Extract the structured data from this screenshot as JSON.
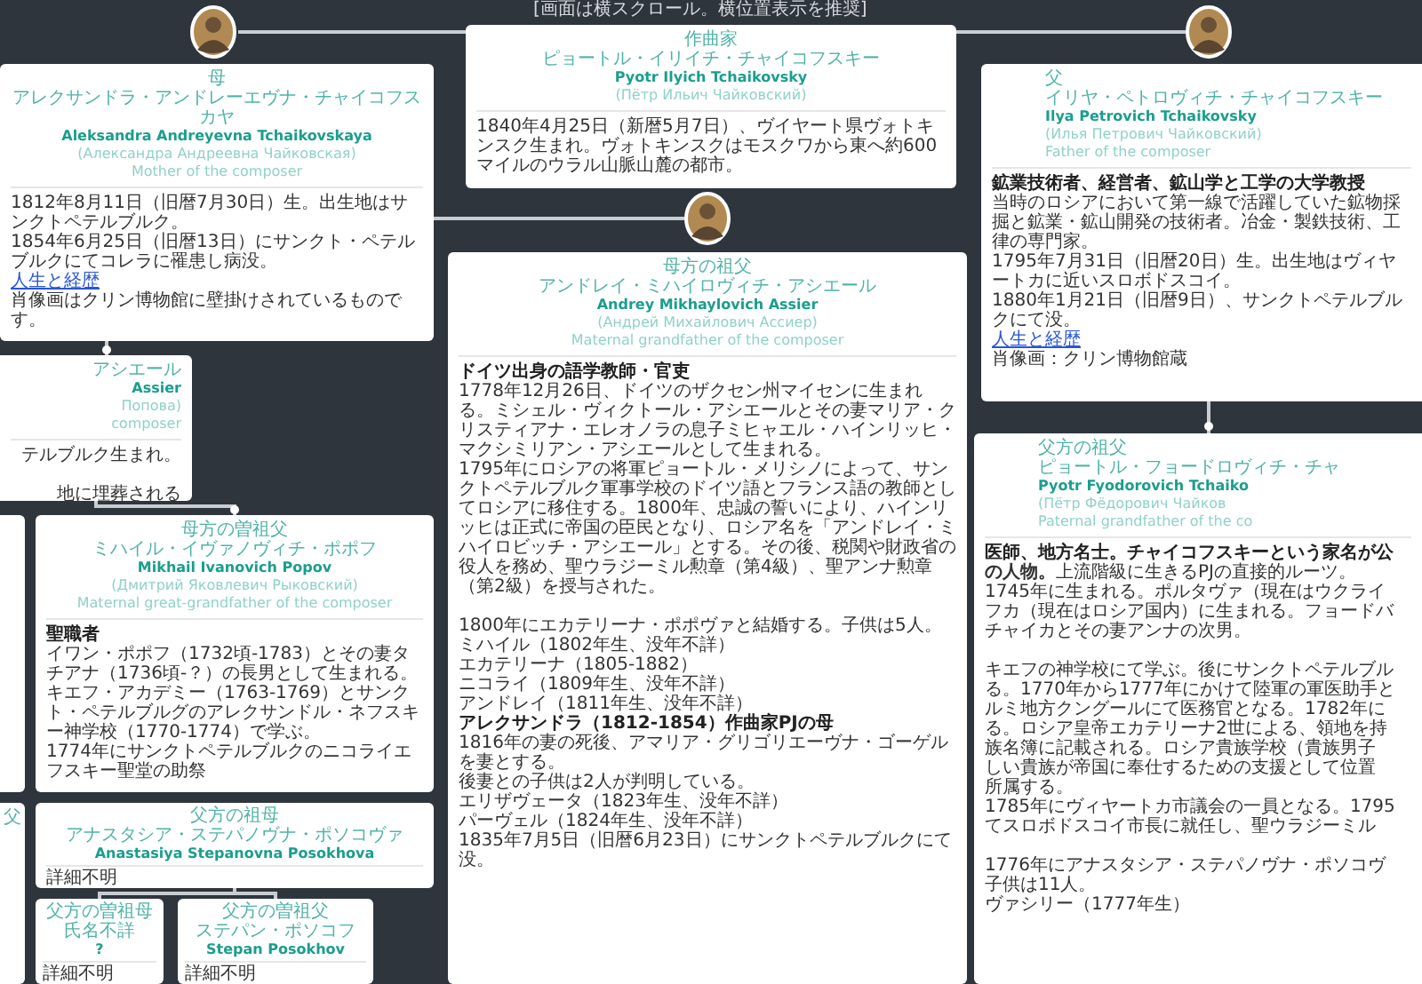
{
  "hint": "[画面は横スクロール。横位置表示を推奨]",
  "people": [
    {
      "role": "作曲家",
      "name_ja": "ピョートル・イリイチ・チャイコフスキー",
      "name_en": "Pyotr Ilyich Tchaikovsky",
      "name_ru": "(Пётр Ильич Чайковский)",
      "portrait": false,
      "bio": [
        {
          "kind": "text",
          "text": "1840年4月25日（新暦5月7日）、ヴイヤート県ヴォトキンスク生まれ。ヴォトキンスクはモスクワから東へ約600マイルのウラル山脈山麓の都市。"
        }
      ]
    },
    {
      "role": "母",
      "name_ja": "アレクサンドラ・アンドレーエヴナ・チャイコフスカヤ",
      "name_en": "Aleksandra Andreyevna Tchaikovskaya",
      "name_ru": "(Александра Андреевна Чайковская)",
      "role_en": "Mother of the composer",
      "portrait": true,
      "bio": [
        {
          "kind": "text",
          "text": "1812年8月11日（旧暦7月30日）生。出生地はサンクトペテルブルク。"
        },
        {
          "kind": "text",
          "text": "1854年6月25日（旧暦13日）にサンクト・ペテルブルクにてコレラに罹患し病没。"
        },
        {
          "kind": "link",
          "text": "人生と経歴"
        },
        {
          "kind": "text",
          "text": "肖像画はクリン博物館に壁掛けされているものです。"
        }
      ]
    },
    {
      "role": "父",
      "name_ja": "イリヤ・ペトロヴィチ・チャイコフスキー",
      "name_en": "Ilya Petrovich Tchaikovsky",
      "name_ru": "(Илья Петрович Чайковский)",
      "role_en": "Father of the composer",
      "portrait": true,
      "bio": [
        {
          "kind": "bold",
          "text": "鉱業技術者、経営者、鉱山学と工学の大学教授"
        },
        {
          "kind": "text",
          "text": "当時のロシアにおいて第一線で活躍していた鉱物採掘と鉱業・鉱山開発の技術者。冶金・製鉄技術、工"
        },
        {
          "kind": "text",
          "text": "律の専門家。"
        },
        {
          "kind": "text",
          "text": "1795年7月31日（旧暦20日）生。出生地はヴィヤートカに近いスロボドスコイ。"
        },
        {
          "kind": "text",
          "text": "1880年1月21日（旧暦9日）、サンクトペテルブルクにて没。"
        },
        {
          "kind": "link",
          "text": "人生と経歴"
        },
        {
          "kind": "text",
          "text": "肖像画：クリン博物館蔵"
        }
      ]
    },
    {
      "name_ja": "アシエール",
      "name_en": "Assier",
      "name_ru": "Попова)",
      "role_en": "composer",
      "portrait": false,
      "bio": [
        {
          "kind": "text",
          "text": "テルブルク生まれ。"
        },
        {
          "kind": "text",
          "text": "地に埋葬される"
        }
      ]
    },
    {
      "role": "母方の祖父",
      "name_ja": "アンドレイ・ミハイロヴィチ・アシエール",
      "name_en": "Andrey Mikhaylovich Assier",
      "name_ru": "(Андрей Михайлович Ассиер)",
      "role_en": "Maternal grandfather of the composer",
      "portrait": true,
      "bio": [
        {
          "kind": "bold",
          "text": "ドイツ出身の語学教師・官吏"
        },
        {
          "kind": "text",
          "text": "1778年12月26日、ドイツのザクセン州マイセンに生まれる。ミシェル・ヴィクトール・アシエールとその妻マリア・クリスティアナ・エレオノラの息子ミヒャエル・ハインリッヒ・マクシミリアン・アシエールとして生まれる。"
        },
        {
          "kind": "text",
          "text": "1795年にロシアの将軍ピョートル・メリシノによって、サンクトペテルブルク軍事学校のドイツ語とフランス語の教師としてロシアに移住する。1800年、忠誠の誓いにより、ハインリッヒは正式に帝国の臣民となり、ロシア名を「アンドレイ・ミハイロビッチ・アシエール」とする。その後、税関や財政省の役人を務め、聖ウラジーミル勲章（第4級）、聖アンナ勲章（第2級）を授与された。"
        },
        {
          "kind": "text",
          "text": "1800年にエカテリーナ・ポポヴァと結婚する。子供は5人。"
        },
        {
          "kind": "text",
          "text": "ミハイル（1802年生、没年不詳）"
        },
        {
          "kind": "text",
          "text": "エカテリーナ（1805-1882）"
        },
        {
          "kind": "text",
          "text": "ニコライ（1809年生、没年不詳）"
        },
        {
          "kind": "text",
          "text": "アンドレイ（1811年生、没年不詳）"
        },
        {
          "kind": "bold",
          "text": "アレクサンドラ（1812-1854）作曲家PJの母"
        },
        {
          "kind": "text",
          "text": "1816年の妻の死後、アマリア・グリゴリエーヴナ・ゴーゲルを妻とする。"
        },
        {
          "kind": "text",
          "text": "後妻との子供は2人が判明している。"
        },
        {
          "kind": "text",
          "text": "エリザヴェータ（1823年生、没年不詳）"
        },
        {
          "kind": "text",
          "text": "パーヴェル（1824年生、没年不詳）"
        },
        {
          "kind": "text",
          "text": "1835年7月5日（旧暦6月23日）にサンクトペテルブルクにて没。"
        }
      ]
    },
    {
      "role": "母方の曽祖父",
      "name_ja": "ミハイル・イヴァノヴィチ・ポポフ",
      "name_en": "Mikhail Ivanovich Popov",
      "name_ru": "(Дмитрий Яковлевич Рыковский)",
      "role_en": "Maternal great-grandfather of the composer",
      "portrait": false,
      "bio": [
        {
          "kind": "bold",
          "text": "聖職者"
        },
        {
          "kind": "text",
          "text": "イワン・ポポフ（1732頃-1783）とその妻タチアナ（1736頃-？）の長男として生まれる。"
        },
        {
          "kind": "text",
          "text": "キエフ・アカデミー（1763-1769）とサンクト・ペテルブルグのアレクサンドル・ネフスキー神学校（1770-1774）で学ぶ。"
        },
        {
          "kind": "text",
          "text": "1774年にサンクトペテルブルクのニコライエフスキー聖堂の助祭"
        }
      ]
    },
    {
      "role": "父方の祖母",
      "name_ja": "アナスタシア・ステパノヴナ・ポソコヴァ",
      "name_en": "Anastasiya Stepanovna Posokhova",
      "portrait": false,
      "bio": [
        {
          "kind": "text",
          "text": "詳細不明"
        }
      ]
    },
    {
      "role": "父方の曽祖母",
      "name_ja": "氏名不詳",
      "name_en": "?",
      "portrait": false,
      "bio": [
        {
          "kind": "text",
          "text": "詳細不明"
        }
      ]
    },
    {
      "role": "父方の曽祖父",
      "name_ja": "ステパン・ポソコフ",
      "name_en": "Stepan Posokhov",
      "portrait": false,
      "bio": [
        {
          "kind": "text",
          "text": "詳細不明"
        }
      ]
    },
    {
      "role": "父方の祖父",
      "name_ja": "ピョートル・フョードロヴィチ・チャ",
      "name_en": "Pyotr Fyodorovich Tchaiko",
      "name_ru": "(Пётр Фёдорович Чайков",
      "role_en": "Paternal grandfather of the co",
      "portrait": false,
      "bio": [
        {
          "kind": "bold",
          "text": "医師、地方名士。チャイコフスキーという家名が公"
        },
        {
          "kind": "text",
          "text": "**の人物。**上流階級に生きるPJの直接的ルーツ。"
        },
        {
          "kind": "text",
          "text": "1745年に生まれる。ポルタヴァ（現在はウクライ"
        },
        {
          "kind": "text",
          "text": "フカ（現在はロシア国内）に生まれる。フョードバ"
        },
        {
          "kind": "text",
          "text": "チャイカとその妻アンナの次男。"
        },
        {
          "kind": "text",
          "text": "キエフの神学校にて学ぶ。後にサンクトペテルブル"
        },
        {
          "kind": "text",
          "text": "る。1770年から1777年にかけて陸軍の軍医助手と"
        },
        {
          "kind": "text",
          "text": "ルミ地方クングールにて医務官となる。1782年に"
        },
        {
          "kind": "text",
          "text": "る。ロシア皇帝エカテリーナ2世による、領地を持"
        },
        {
          "kind": "text",
          "text": "族名簿に記載される。ロシア貴族学校（貴族男子"
        },
        {
          "kind": "text",
          "text": "しい貴族が帝国に奉仕するための支援として位置"
        },
        {
          "kind": "text",
          "text": "所属する。"
        },
        {
          "kind": "text",
          "text": "1785年にヴィヤートカ市議会の一員となる。1795"
        },
        {
          "kind": "text",
          "text": "てスロボドスコイ市長に就任し、聖ウラジーミル"
        },
        {
          "kind": "text",
          "text": "1776年にアナスタシア・ステパノヴナ・ポソコヴ"
        },
        {
          "kind": "text",
          "text": "子供は11人。"
        },
        {
          "kind": "text",
          "text": "ヴァシリー（1777年生）"
        }
      ]
    },
    {
      "role": "父",
      "portrait": false
    }
  ]
}
